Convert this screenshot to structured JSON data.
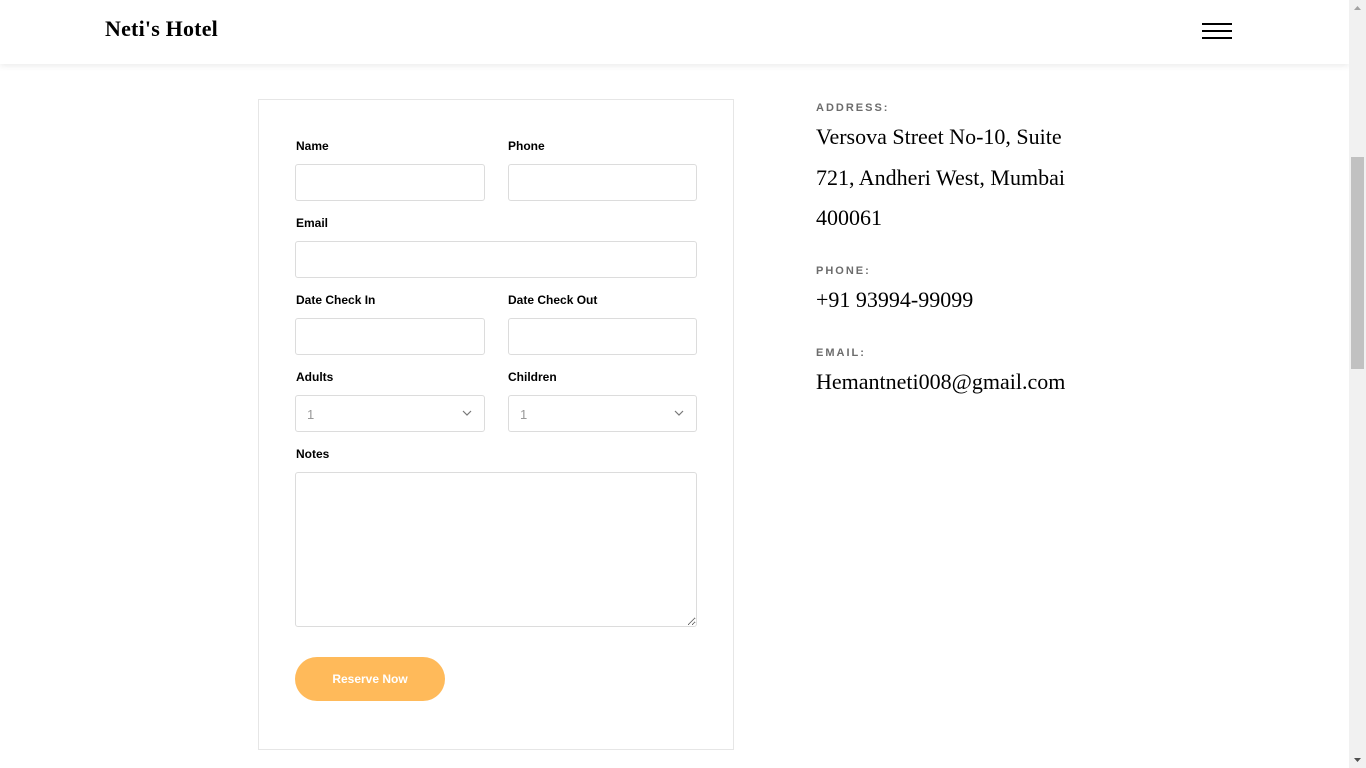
{
  "header": {
    "brand": "Neti's Hotel",
    "menu_icon": "hamburger-menu-icon"
  },
  "form": {
    "name_label": "Name",
    "phone_label": "Phone",
    "email_label": "Email",
    "checkin_label": "Date Check In",
    "checkout_label": "Date Check Out",
    "adults_label": "Adults",
    "adults_value": "1",
    "children_label": "Children",
    "children_value": "1",
    "notes_label": "Notes",
    "submit_label": "Reserve Now"
  },
  "contact": {
    "address_label": "ADDRESS:",
    "address_value": "Versova Street No-10, Suite 721, Andheri West, Mumbai 400061",
    "phone_label": "PHONE:",
    "phone_value": "+91 93994-99099",
    "email_label": "EMAIL:",
    "email_value": "Hemantneti008@gmail.com"
  },
  "colors": {
    "accent": "#ffba5a",
    "label_gray": "#6c6c6c",
    "border": "#dcdcdc"
  }
}
